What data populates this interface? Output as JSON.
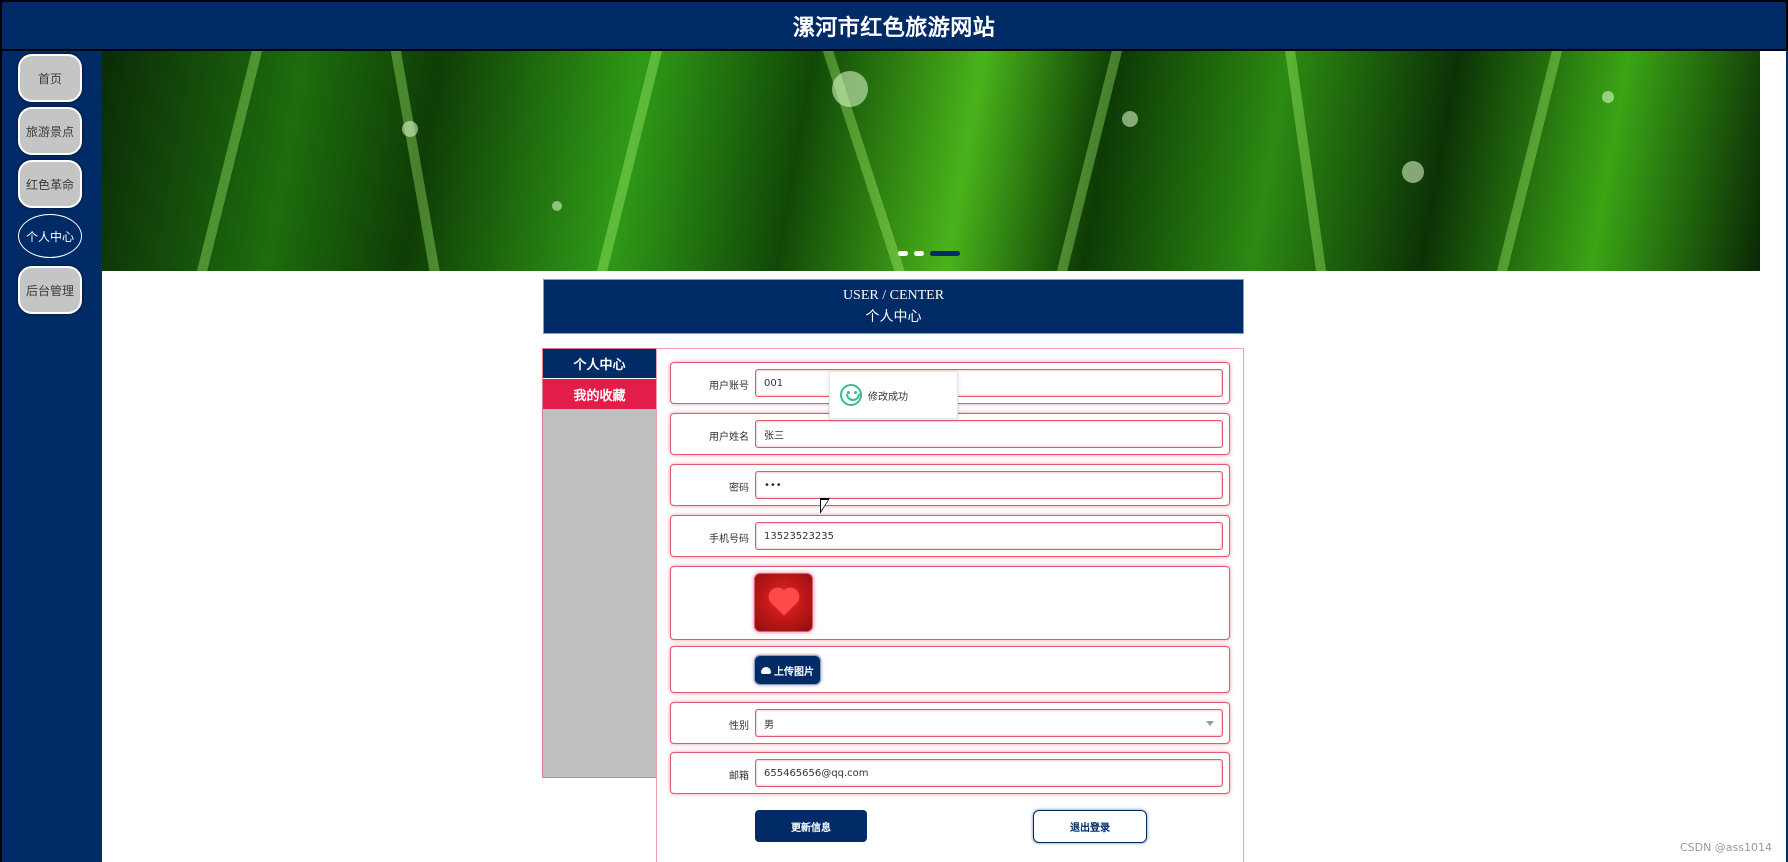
{
  "site": {
    "title": "漯河市红色旅游网站"
  },
  "nav": {
    "items": [
      {
        "label": "首页"
      },
      {
        "label": "旅游景点"
      },
      {
        "label": "红色革命"
      },
      {
        "label": "个人中心"
      },
      {
        "label": "后台管理"
      }
    ],
    "active": "个人中心"
  },
  "carousel": {
    "slides": 3,
    "current": 3
  },
  "user_center": {
    "en_title": "USER / CENTER",
    "cn_title": "个人中心"
  },
  "side_menu": {
    "items": [
      {
        "label": "个人中心"
      },
      {
        "label": "我的收藏"
      }
    ]
  },
  "form": {
    "account": {
      "label": "用户账号",
      "value": "001"
    },
    "name": {
      "label": "用户姓名",
      "value": "张三"
    },
    "password": {
      "label": "密码",
      "value": "•••"
    },
    "phone": {
      "label": "手机号码",
      "value": "13523523235"
    },
    "upload_label": "上传图片",
    "gender": {
      "label": "性别",
      "value": "男"
    },
    "email": {
      "label": "邮箱",
      "value": "655465656@qq.com"
    }
  },
  "toast": {
    "message": "修改成功"
  },
  "actions": {
    "update": "更新信息",
    "logout": "退出登录"
  },
  "watermark": "CSDN @ass1014",
  "colors": {
    "primary": "#002b66",
    "accent": "#e11d48",
    "menu_gray": "#c0c0c0"
  }
}
